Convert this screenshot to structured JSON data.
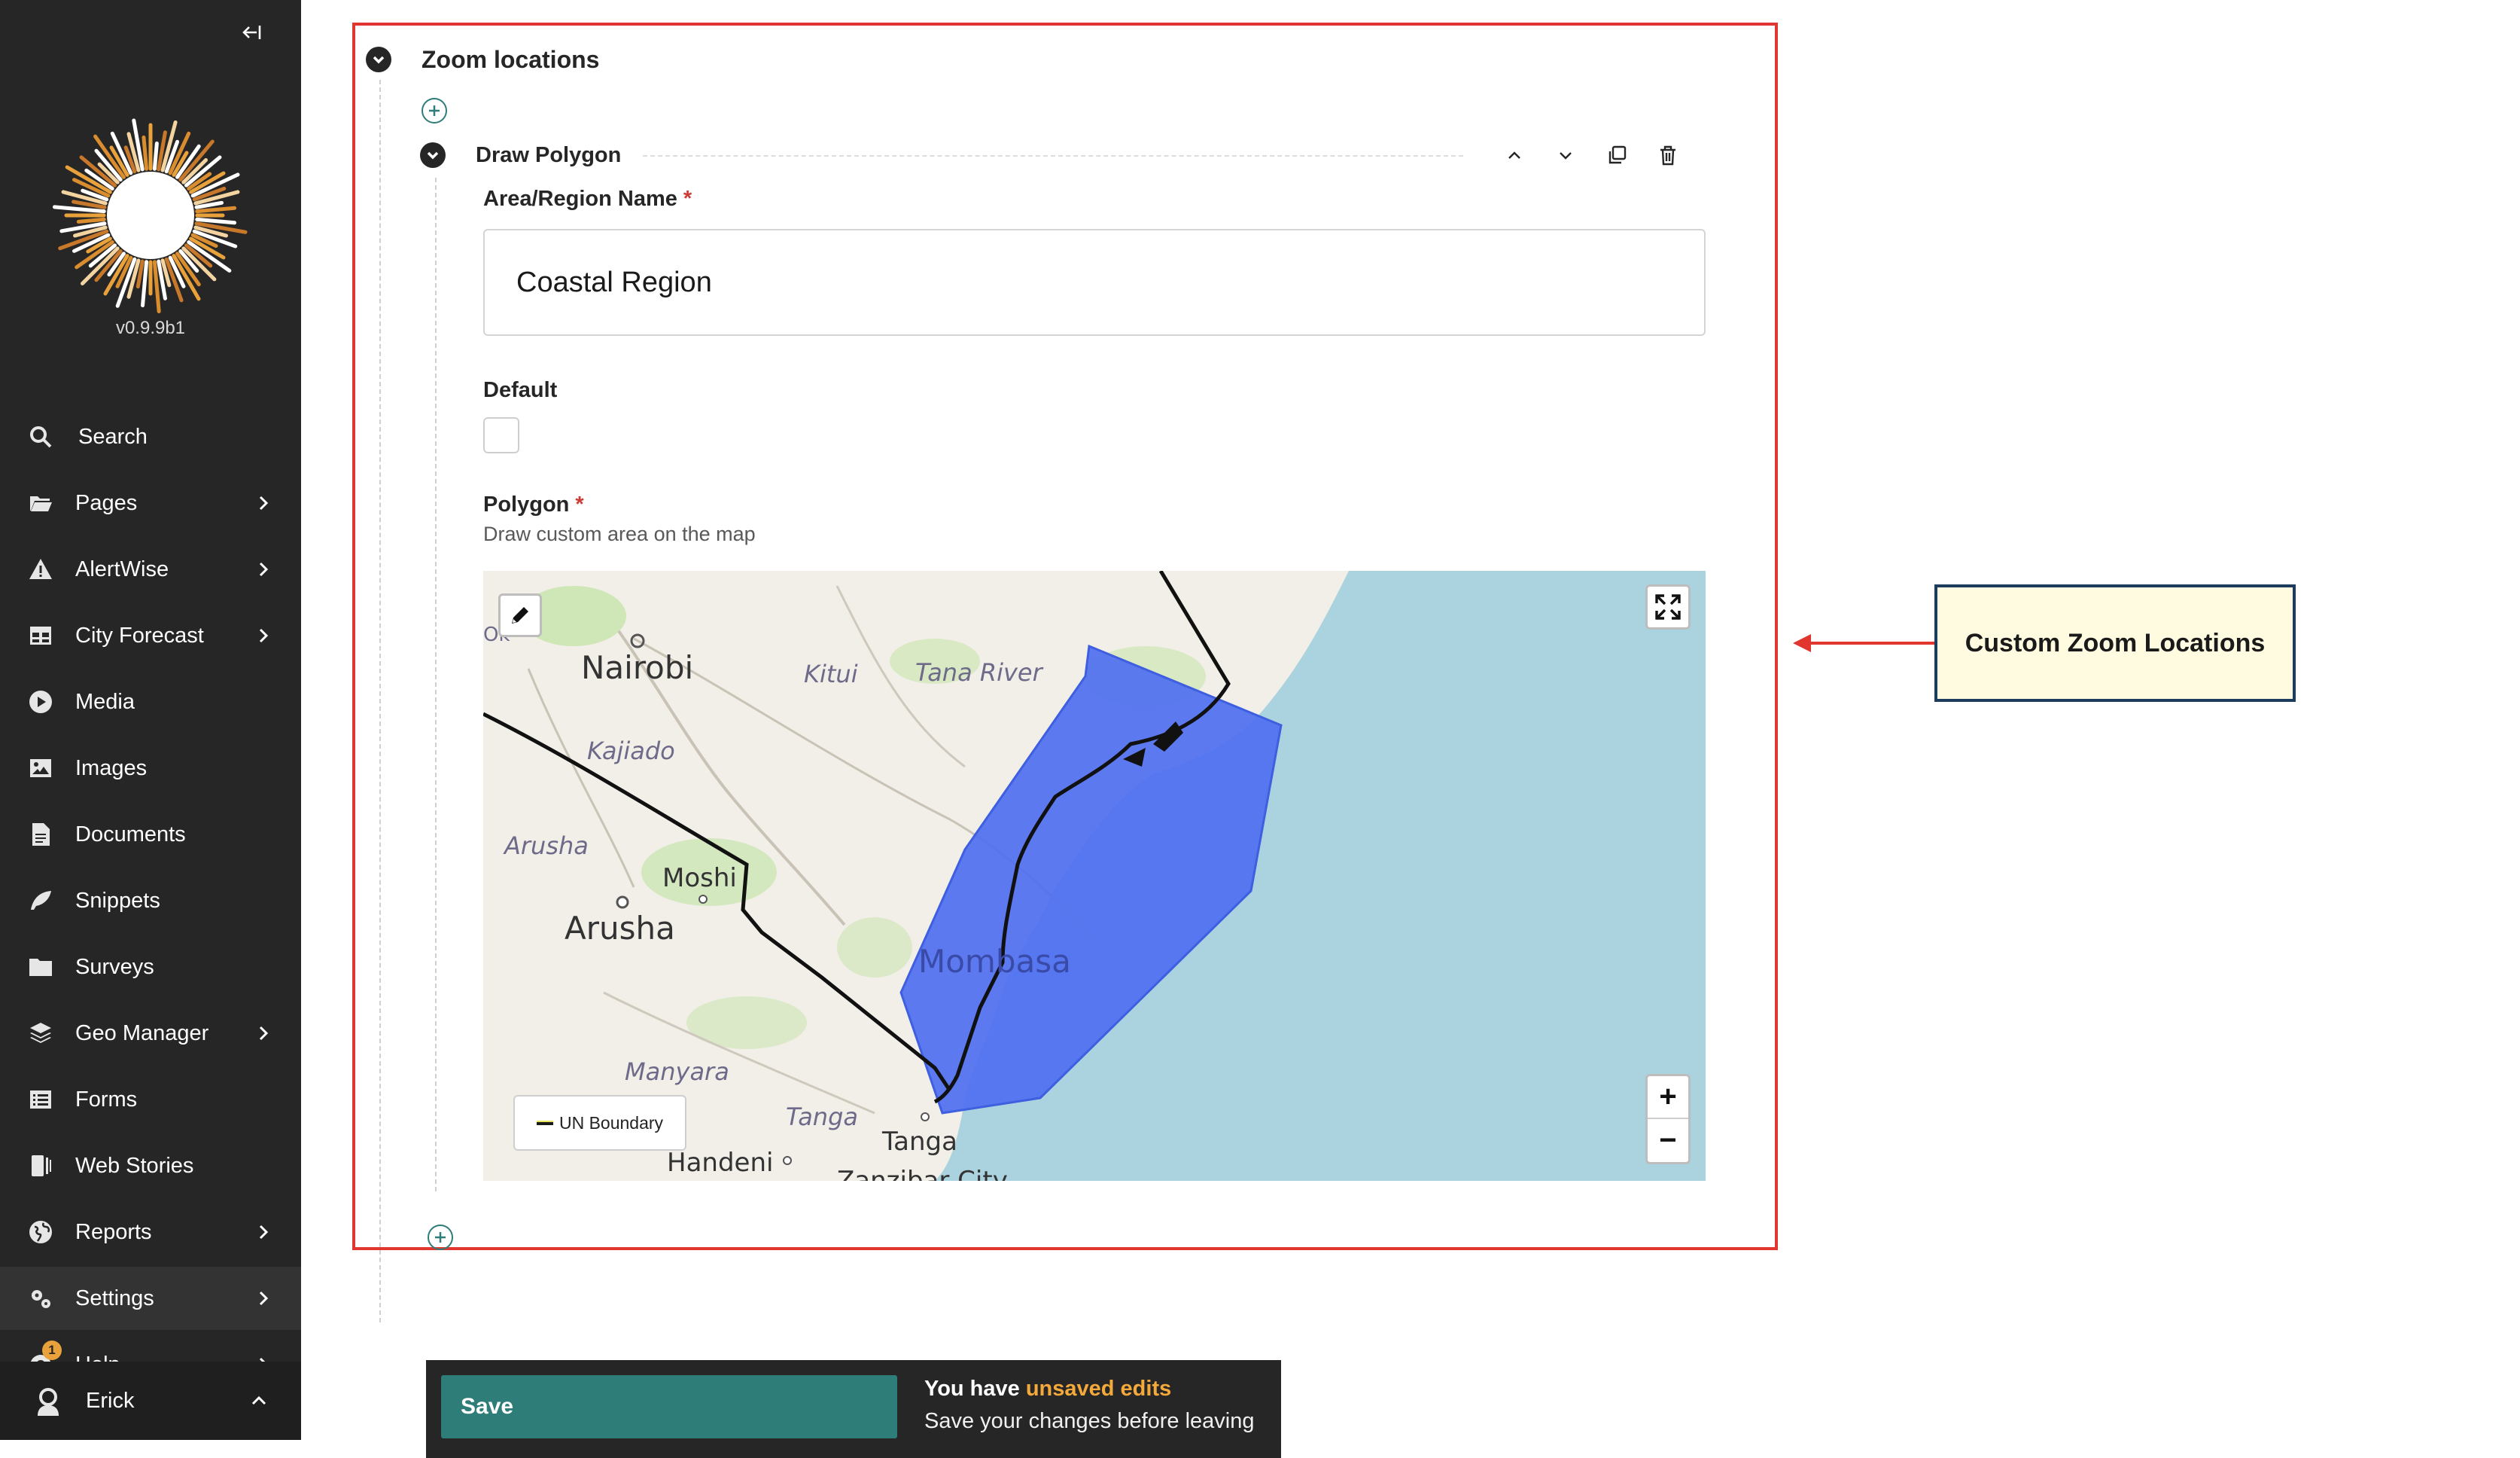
{
  "sidebar": {
    "collapse_icon": "collapse-left-icon",
    "version": "v0.9.9b1",
    "items": [
      {
        "label": "Search",
        "icon": "search-icon",
        "has_submenu": false
      },
      {
        "label": "Pages",
        "icon": "folder-open-icon",
        "has_submenu": true
      },
      {
        "label": "AlertWise",
        "icon": "warning-icon",
        "has_submenu": true
      },
      {
        "label": "City Forecast",
        "icon": "table-icon",
        "has_submenu": true
      },
      {
        "label": "Media",
        "icon": "play-icon",
        "has_submenu": false
      },
      {
        "label": "Images",
        "icon": "image-icon",
        "has_submenu": false
      },
      {
        "label": "Documents",
        "icon": "document-icon",
        "has_submenu": false
      },
      {
        "label": "Snippets",
        "icon": "snippet-icon",
        "has_submenu": false
      },
      {
        "label": "Surveys",
        "icon": "folder-icon",
        "has_submenu": false
      },
      {
        "label": "Geo Manager",
        "icon": "layers-icon",
        "has_submenu": true
      },
      {
        "label": "Forms",
        "icon": "form-icon",
        "has_submenu": false
      },
      {
        "label": "Web Stories",
        "icon": "stories-icon",
        "has_submenu": false
      },
      {
        "label": "Reports",
        "icon": "globe-icon",
        "has_submenu": true
      },
      {
        "label": "Settings",
        "icon": "cogs-icon",
        "has_submenu": true
      },
      {
        "label": "Help",
        "icon": "help-icon",
        "has_submenu": true,
        "badge": "1"
      }
    ],
    "account": {
      "name": "Erick",
      "icon": "astronaut-avatar-icon"
    }
  },
  "editor": {
    "section_title": "Zoom locations",
    "block": {
      "title": "Draw Polygon",
      "actions": [
        "move-up-icon",
        "move-down-icon",
        "duplicate-icon",
        "delete-icon"
      ]
    },
    "fields": {
      "area_name": {
        "label": "Area/Region Name",
        "required_mark": "*",
        "value": "Coastal Region"
      },
      "default": {
        "label": "Default",
        "checked": false
      },
      "polygon": {
        "label": "Polygon",
        "required_mark": "*",
        "help": "Draw custom area on the map"
      }
    }
  },
  "map": {
    "labels": {
      "nairobi": "Nairobi",
      "kitui": "Kitui",
      "tana_river": "Tana River",
      "kajiado": "Kajiado",
      "arusha_region": "Arusha",
      "moshi": "Moshi",
      "arusha": "Arusha",
      "mombasa": "Mombasa",
      "manyara": "Manyara",
      "tanga_region": "Tanga",
      "tanga": "Tanga",
      "handeni": "Handeni",
      "zanzibar": "Zanzibar City",
      "edge_ok": "Ok"
    },
    "legend": "UN Boundary",
    "zoom_in": "+",
    "zoom_out": "−",
    "colors": {
      "sea": "#aad3df",
      "land": "#f2efe9",
      "polygon": "#4f6ff0",
      "boundary": "#111111"
    }
  },
  "annotation": {
    "callout": "Custom Zoom Locations",
    "color": "#e0362f"
  },
  "footer": {
    "save_label": "Save",
    "unsaved_prefix": "You have ",
    "unsaved_highlight": "unsaved edits",
    "unsaved_note": "Save your changes before leaving"
  }
}
